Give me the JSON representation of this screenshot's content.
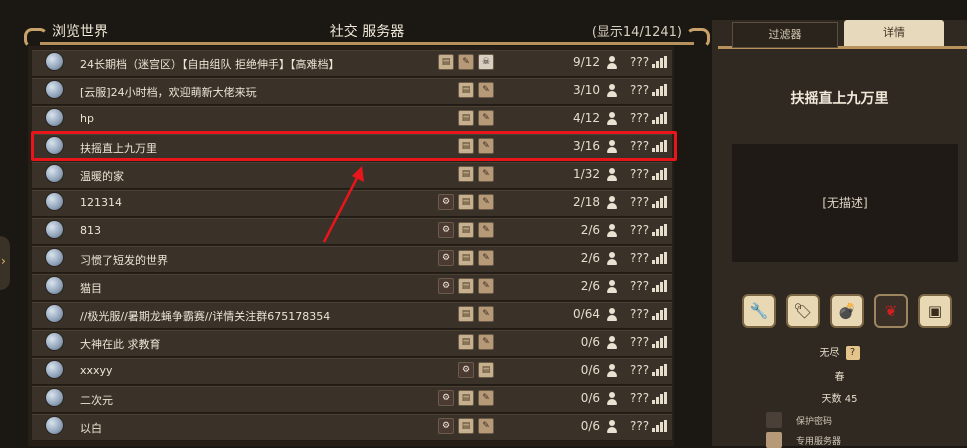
{
  "header": {
    "title": "浏览世界",
    "center": "社交 服务器",
    "count": "(显示14/1241)"
  },
  "rows": [
    {
      "name": "24长期档（迷宫区）【自由组队 拒绝伸手】【高难档】",
      "players": "9/12",
      "ping": "???",
      "icons": [
        "scroll",
        "tan",
        "skull"
      ]
    },
    {
      "name": "[云服]24小时档，欢迎萌新大佬来玩",
      "players": "3/10",
      "ping": "???",
      "icons": [
        "scroll",
        "tan"
      ]
    },
    {
      "name": "hp",
      "players": "4/12",
      "ping": "???",
      "icons": [
        "scroll",
        "tan"
      ]
    },
    {
      "name": "扶摇直上九万里",
      "players": "3/16",
      "ping": "???",
      "icons": [
        "scroll",
        "tan"
      ]
    },
    {
      "name": "温暖的家",
      "players": "1/32",
      "ping": "???",
      "icons": [
        "scroll",
        "tan"
      ]
    },
    {
      "name": "121314",
      "players": "2/18",
      "ping": "???",
      "icons": [
        "dark",
        "scroll",
        "tan"
      ]
    },
    {
      "name": "813",
      "players": "2/6",
      "ping": "???",
      "icons": [
        "dark",
        "scroll",
        "tan"
      ]
    },
    {
      "name": "习惯了短发的世界",
      "players": "2/6",
      "ping": "???",
      "icons": [
        "dark",
        "scroll",
        "tan"
      ]
    },
    {
      "name": "猫目",
      "players": "2/6",
      "ping": "???",
      "icons": [
        "dark",
        "scroll",
        "tan"
      ]
    },
    {
      "name": "//极光服//暑期龙蝇争霸赛//详情关注群675178354",
      "players": "0/64",
      "ping": "???",
      "icons": [
        "scroll",
        "tan"
      ]
    },
    {
      "name": "大神在此 求教育",
      "players": "0/6",
      "ping": "???",
      "icons": [
        "scroll",
        "tan"
      ]
    },
    {
      "name": "xxxyy",
      "players": "0/6",
      "ping": "???",
      "icons": [
        "dark",
        "scroll"
      ]
    },
    {
      "name": "二次元",
      "players": "0/6",
      "ping": "???",
      "icons": [
        "dark",
        "scroll",
        "tan"
      ]
    },
    {
      "name": "以白",
      "players": "0/6",
      "ping": "???",
      "icons": [
        "dark",
        "scroll",
        "tan"
      ]
    }
  ],
  "selected_index": 3,
  "details": {
    "tab_filter": "过滤器",
    "tab_details": "详情",
    "server_name": "扶摇直上九万里",
    "description": "[无描述]",
    "mode_icons": [
      "wrench-icon",
      "tag-icon",
      "bomb-icon",
      "red-tentacle-icon",
      "portrait-icon"
    ],
    "mode_glyphs": [
      "🔧",
      "🏷",
      "💣",
      "❦",
      "▣"
    ],
    "endless_label": "无尽",
    "season": "春",
    "days_label": "天数",
    "days_value": "45",
    "password_label": "保护密码",
    "dedicated_label": "专用服务器"
  }
}
